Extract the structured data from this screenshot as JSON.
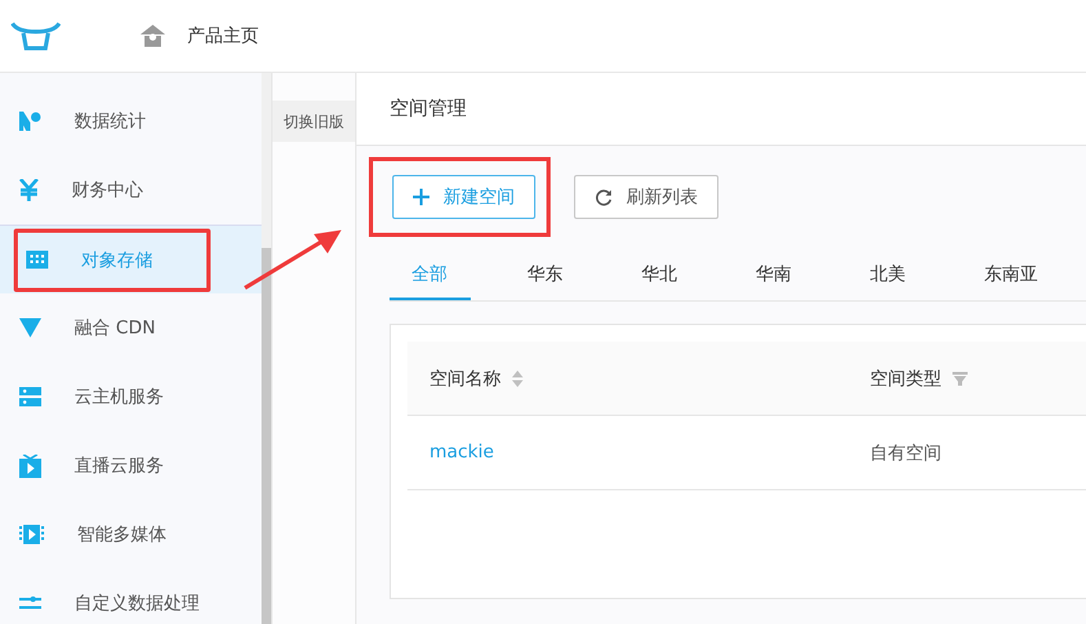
{
  "header": {
    "home_link": "产品主页"
  },
  "sidebar": {
    "items": [
      {
        "label": "数据统计",
        "selected": false,
        "highlighted": false
      },
      {
        "label": "财务中心",
        "selected": false,
        "highlighted": false
      },
      {
        "label": "对象存储",
        "selected": true,
        "highlighted": true
      },
      {
        "label": "融合 CDN",
        "selected": false,
        "highlighted": false
      },
      {
        "label": "云主机服务",
        "selected": false,
        "highlighted": false
      },
      {
        "label": "直播云服务",
        "selected": false,
        "highlighted": false
      },
      {
        "label": "智能多媒体",
        "selected": false,
        "highlighted": false
      },
      {
        "label": "自定义数据处理",
        "selected": false,
        "highlighted": false
      }
    ]
  },
  "switch_old_version": "切换旧版",
  "page_title": "空间管理",
  "buttons": [
    {
      "kind": "add",
      "label": "新建空间",
      "highlighted": true
    },
    {
      "kind": "refresh",
      "label": "刷新列表",
      "highlighted": false
    }
  ],
  "annotation_arrow": true,
  "tabs": [
    {
      "label": "全部",
      "selected": true
    },
    {
      "label": "华东",
      "selected": false
    },
    {
      "label": "华北",
      "selected": false
    },
    {
      "label": "华南",
      "selected": false
    },
    {
      "label": "北美",
      "selected": false
    },
    {
      "label": "东南亚",
      "selected": false
    }
  ],
  "table": {
    "columns": [
      {
        "label": "空间名称",
        "kind": "sort"
      },
      {
        "label": "空间类型",
        "kind": "filter"
      }
    ],
    "rows": [
      [
        "mackie",
        "自有空间"
      ]
    ]
  }
}
